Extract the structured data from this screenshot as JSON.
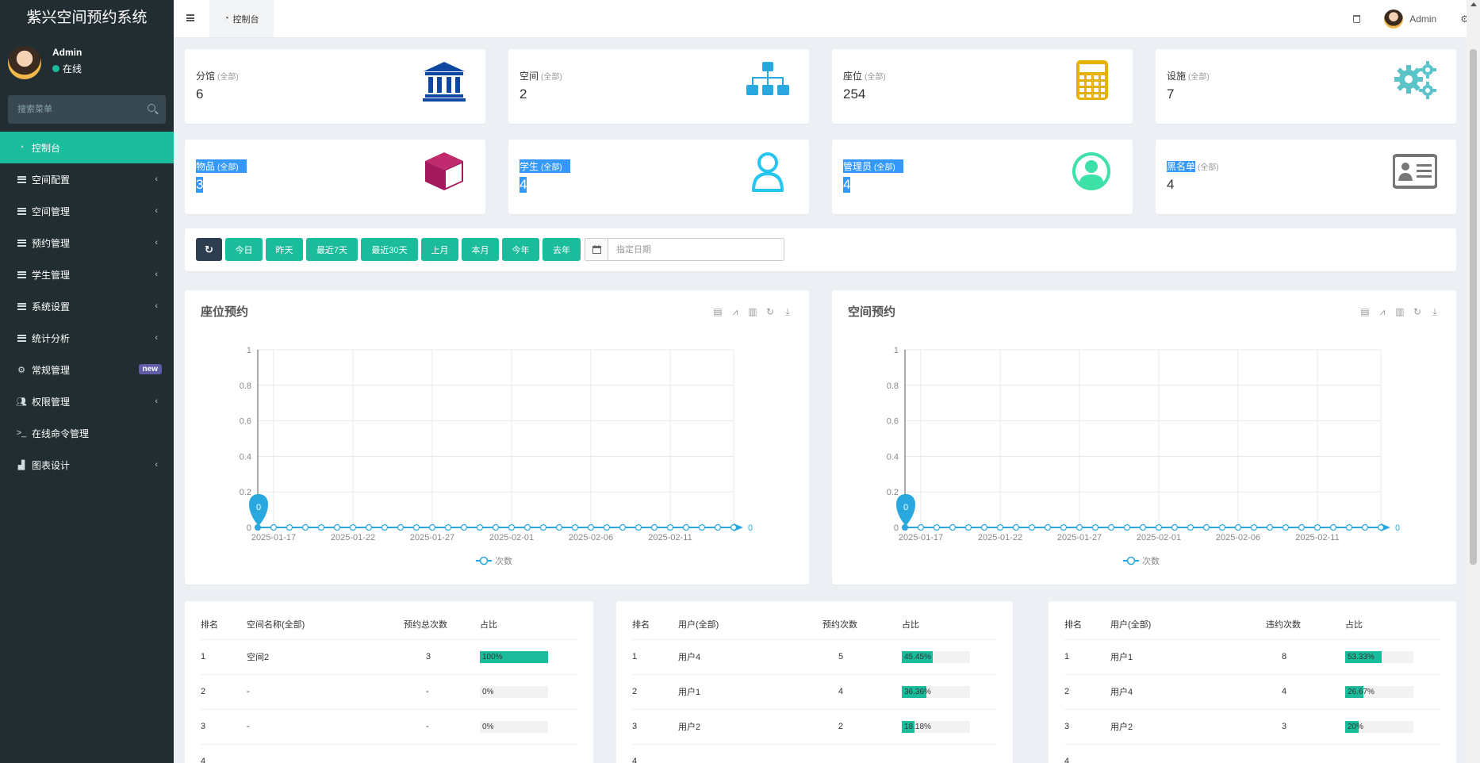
{
  "app": {
    "title": "紫兴空间预约系统"
  },
  "user": {
    "name": "Admin",
    "status": "在线"
  },
  "search": {
    "placeholder": "搜索菜单"
  },
  "menu": [
    {
      "label": "控制台",
      "icon": "dashboard-icon",
      "active": true
    },
    {
      "label": "空间配置",
      "icon": "list-icon",
      "chevron": true
    },
    {
      "label": "空间管理",
      "icon": "list-icon",
      "chevron": true
    },
    {
      "label": "预约管理",
      "icon": "list-icon",
      "chevron": true
    },
    {
      "label": "学生管理",
      "icon": "list-icon",
      "chevron": true
    },
    {
      "label": "系统设置",
      "icon": "list-icon",
      "chevron": true
    },
    {
      "label": "统计分析",
      "icon": "list-icon",
      "chevron": true
    },
    {
      "label": "常规管理",
      "icon": "gears-icon",
      "badge": "new"
    },
    {
      "label": "权限管理",
      "icon": "users-icon",
      "chevron": true
    },
    {
      "label": "在线命令管理",
      "icon": "terminal-icon"
    },
    {
      "label": "图表设计",
      "icon": "bar-chart-icon",
      "chevron": true
    }
  ],
  "header": {
    "tab_label": "控制台",
    "user_name": "Admin"
  },
  "stats": [
    {
      "label": "分馆",
      "scope": "(全部)",
      "value": "6",
      "icon": "bank-icon",
      "color": "#0d47a1"
    },
    {
      "label": "空间",
      "scope": "(全部)",
      "value": "2",
      "icon": "sitemap-icon",
      "color": "#29a8e0"
    },
    {
      "label": "座位",
      "scope": "(全部)",
      "value": "254",
      "icon": "calculator-icon",
      "color": "#e8b100"
    },
    {
      "label": "设施",
      "scope": "(全部)",
      "value": "7",
      "icon": "gears-icon",
      "color": "#5bc4c8"
    },
    {
      "label": "物品",
      "scope": "(全部)",
      "value": "3",
      "icon": "cube-icon",
      "color": "#a3195b"
    },
    {
      "label": "学生",
      "scope": "(全部)",
      "value": "4",
      "icon": "user-icon",
      "color": "#26c6f0"
    },
    {
      "label": "管理员",
      "scope": "(全部)",
      "value": "4",
      "icon": "user-circle-icon",
      "color": "#3de0a6"
    },
    {
      "label": "黑名单",
      "scope": "(全部)",
      "value": "4",
      "icon": "id-card-icon",
      "color": "#777777"
    }
  ],
  "filters": {
    "buttons": [
      "今日",
      "昨天",
      "最近7天",
      "最近30天",
      "上月",
      "本月",
      "今年",
      "去年"
    ],
    "date_placeholder": "指定日期"
  },
  "chart_data": [
    {
      "type": "line",
      "title": "座位预约",
      "x_tick_labels": [
        "2025-01-17",
        "2025-01-22",
        "2025-01-27",
        "2025-02-01",
        "2025-02-06",
        "2025-02-11"
      ],
      "x_start": "2025-01-17",
      "point_count": 31,
      "series": [
        {
          "name": "次数",
          "values": [
            0,
            0,
            0,
            0,
            0,
            0,
            0,
            0,
            0,
            0,
            0,
            0,
            0,
            0,
            0,
            0,
            0,
            0,
            0,
            0,
            0,
            0,
            0,
            0,
            0,
            0,
            0,
            0,
            0,
            0,
            0
          ]
        }
      ],
      "y_ticks": [
        "0",
        "0.2",
        "0.4",
        "0.6",
        "0.8",
        "1"
      ],
      "ylim": [
        0,
        1
      ],
      "annotations": {
        "max_pin": "0",
        "end_label": "0"
      },
      "legend": "bottom-center",
      "color": "#29a8e0"
    },
    {
      "type": "line",
      "title": "空间预约",
      "x_tick_labels": [
        "2025-01-17",
        "2025-01-22",
        "2025-01-27",
        "2025-02-01",
        "2025-02-06",
        "2025-02-11"
      ],
      "x_start": "2025-01-17",
      "point_count": 31,
      "series": [
        {
          "name": "次数",
          "values": [
            0,
            0,
            0,
            0,
            0,
            0,
            0,
            0,
            0,
            0,
            0,
            0,
            0,
            0,
            0,
            0,
            0,
            0,
            0,
            0,
            0,
            0,
            0,
            0,
            0,
            0,
            0,
            0,
            0,
            0,
            0
          ]
        }
      ],
      "y_ticks": [
        "0",
        "0.2",
        "0.4",
        "0.6",
        "0.8",
        "1"
      ],
      "ylim": [
        0,
        1
      ],
      "annotations": {
        "max_pin": "0",
        "end_label": "0"
      },
      "legend": "bottom-center",
      "color": "#29a8e0"
    }
  ],
  "tables": [
    {
      "headers": [
        "排名",
        "空间名称(全部)",
        "预约总次数",
        "占比"
      ],
      "rows": [
        {
          "rank": "1",
          "name": "空间2",
          "count": "3",
          "pct_label": "100%",
          "pct": 100
        },
        {
          "rank": "2",
          "name": "-",
          "count": "-",
          "pct_label": "0%",
          "pct": 0
        },
        {
          "rank": "3",
          "name": "-",
          "count": "-",
          "pct_label": "0%",
          "pct": 0
        },
        {
          "rank": "4",
          "name": "",
          "count": "",
          "pct_label": "",
          "pct": 0
        }
      ]
    },
    {
      "headers": [
        "排名",
        "用户(全部)",
        "预约次数",
        "占比"
      ],
      "rows": [
        {
          "rank": "1",
          "name": "用户4",
          "count": "5",
          "pct_label": "45.45%",
          "pct": 45.45
        },
        {
          "rank": "2",
          "name": "用户1",
          "count": "4",
          "pct_label": "36.36%",
          "pct": 36.36
        },
        {
          "rank": "3",
          "name": "用户2",
          "count": "2",
          "pct_label": "18.18%",
          "pct": 18.18
        },
        {
          "rank": "4",
          "name": "",
          "count": "",
          "pct_label": "",
          "pct": 0
        }
      ]
    },
    {
      "headers": [
        "排名",
        "用户(全部)",
        "违约次数",
        "占比"
      ],
      "rows": [
        {
          "rank": "1",
          "name": "用户1",
          "count": "8",
          "pct_label": "53.33%",
          "pct": 53.33
        },
        {
          "rank": "2",
          "name": "用户4",
          "count": "4",
          "pct_label": "26.67%",
          "pct": 26.67
        },
        {
          "rank": "3",
          "name": "用户2",
          "count": "3",
          "pct_label": "20%",
          "pct": 20
        },
        {
          "rank": "4",
          "name": "",
          "count": "",
          "pct_label": "",
          "pct": 0
        }
      ]
    }
  ],
  "colors": {
    "accent": "#1abc9c",
    "sidebar": "#222d32",
    "dark_button": "#2c3e50",
    "badge": "#605ca8",
    "selection": "#3399ff"
  }
}
